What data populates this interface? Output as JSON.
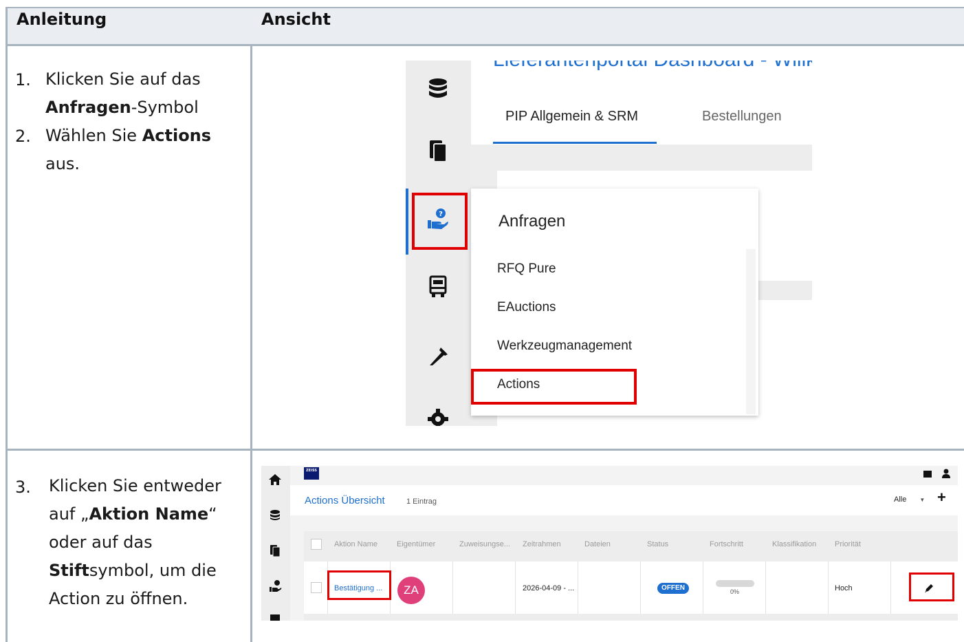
{
  "header": {
    "col1": "Anleitung",
    "col2": "Ansicht"
  },
  "steps": {
    "s1": {
      "num": "1.",
      "line1": "Klicken Sie auf das",
      "bold": "Anfragen",
      "rest": "-Symbol"
    },
    "s2": {
      "num": "2.",
      "pre": "Wählen Sie ",
      "bold": "Actions",
      "line2": "aus."
    },
    "s3": {
      "num": "3.",
      "line1": "Klicken Sie entweder",
      "pre2": "auf „",
      "bold2": "Aktion Name",
      "post2": "“",
      "line3": "oder auf das",
      "bold4": "Stift",
      "post4": "symbol, um die",
      "line5": "Action zu öffnen."
    }
  },
  "shot1": {
    "title": "Lieferantenportal Dashboard - Willkommen",
    "tab_active": "PIP Allgemein & SRM",
    "tab_inactive": "Bestellungen",
    "menu_head": "Anfragen",
    "menu_items": [
      "RFQ Pure",
      "EAuctions",
      "Werkzeugmanagement",
      "Actions"
    ],
    "accent": "#1e6fd0",
    "highlight": "#e00000"
  },
  "shot2": {
    "logo": "ZEISS",
    "title": "Actions Übersicht",
    "count": "1 Eintrag",
    "filter": "Alle",
    "columns": [
      "Aktion Name",
      "Eigentümer",
      "Zuweisungse...",
      "Zeitrahmen",
      "Dateien",
      "Status",
      "Fortschritt",
      "Klassifikation",
      "Priorität"
    ],
    "row": {
      "name": "Bestätigung ...",
      "owner_initials": "ZA",
      "timeframe": "2026-04-09 - ...",
      "status": "OFFEN",
      "progress_pct": 0,
      "progress_label": "0%",
      "priority": "Hoch"
    },
    "status_color": "#1e6fd0",
    "avatar_color": "#e0407a"
  }
}
